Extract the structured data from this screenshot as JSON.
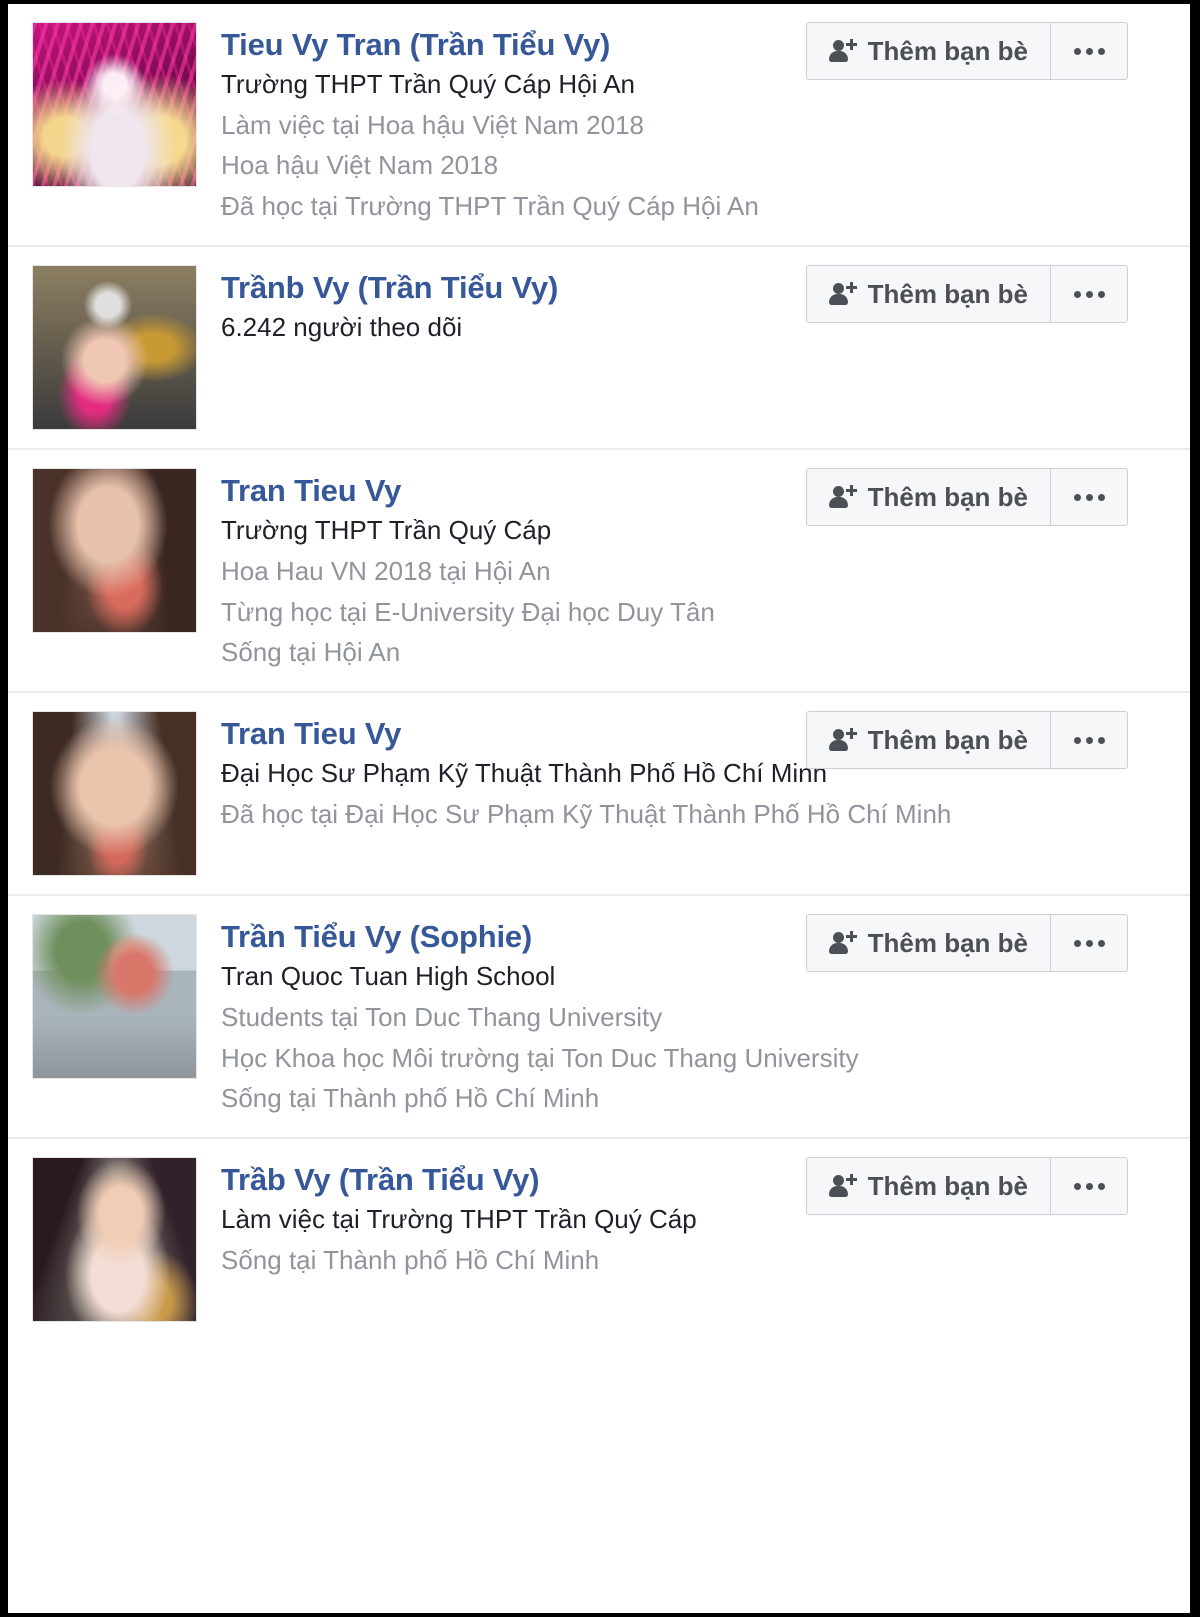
{
  "page": {
    "title": "Facebook people search results",
    "accent_link_color": "#365899",
    "primary_text_color": "#1d2129",
    "secondary_text_color": "#90949c",
    "button_bg_color": "#f6f7f9",
    "button_border_color": "#ccd0d5",
    "separator_color": "#e9ebee"
  },
  "buttons": {
    "add_friend_label": "Thêm bạn bè",
    "add_friend_icon": "person-plus-icon",
    "more_icon": "ellipsis-icon"
  },
  "results": [
    {
      "name": "Tieu Vy Tran (Trần Tiểu Vy)",
      "avatar": "av1",
      "lines": [
        {
          "text": "Trường THPT Trần Quý Cáp Hội An",
          "style": "primary"
        },
        {
          "text": "Làm việc tại Hoa hậu Việt Nam 2018",
          "style": "secondary"
        },
        {
          "text": "Hoa hậu Việt Nam 2018",
          "style": "secondary"
        },
        {
          "text": "Đã học tại Trường THPT Trần Quý Cáp Hội An",
          "style": "secondary"
        }
      ]
    },
    {
      "name": "Trầnb Vy (Trần Tiểu Vy)",
      "avatar": "av2",
      "lines": [
        {
          "text": "6.242 người theo dõi",
          "style": "primary"
        }
      ]
    },
    {
      "name": "Tran Tieu Vy",
      "avatar": "av3",
      "lines": [
        {
          "text": "Trường THPT Trần Quý Cáp",
          "style": "primary"
        },
        {
          "text": "Hoa Hau VN 2018 tại Hội An",
          "style": "secondary"
        },
        {
          "text": "Từng học tại E-University Đại học Duy Tân",
          "style": "secondary"
        },
        {
          "text": "Sống tại Hội An",
          "style": "secondary"
        }
      ]
    },
    {
      "name": "Tran Tieu Vy",
      "avatar": "av4",
      "lines": [
        {
          "text": "Đại Học Sư Phạm Kỹ Thuật Thành Phố Hồ Chí Minh",
          "style": "primary"
        },
        {
          "text": "Đã học tại Đại Học Sư Phạm Kỹ Thuật Thành Phố Hồ Chí Minh",
          "style": "secondary"
        }
      ]
    },
    {
      "name": "Trần Tiểu Vy (Sophie)",
      "avatar": "av5",
      "lines": [
        {
          "text": "Tran Quoc Tuan High School",
          "style": "primary"
        },
        {
          "text": "Students tại Ton Duc Thang University",
          "style": "secondary"
        },
        {
          "text": "Học Khoa học Môi trường tại Ton Duc Thang University",
          "style": "secondary"
        },
        {
          "text": "Sống tại Thành phố Hồ Chí Minh",
          "style": "secondary"
        }
      ]
    },
    {
      "name": "Trầb Vy (Trần Tiểu Vy)",
      "avatar": "av6",
      "lines": [
        {
          "text": "Làm việc tại Trường THPT Trần Quý Cáp",
          "style": "primary"
        },
        {
          "text": "Sống tại Thành phố Hồ Chí Minh",
          "style": "secondary"
        }
      ]
    }
  ]
}
